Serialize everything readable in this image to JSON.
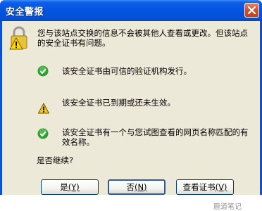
{
  "window": {
    "title": "安全警报",
    "close_icon": "close-icon"
  },
  "intro": {
    "icon": "lock-warning-icon",
    "text_line1": "您与该站点交换的信息不会被其他人查看或更改。但该站点",
    "text_line2": "的安全证书有问题。"
  },
  "checks": [
    {
      "icon": "check-ok-icon",
      "status": "ok",
      "line1": "该安全证书由可信的验证机构发行。",
      "line2": ""
    },
    {
      "icon": "warning-icon",
      "status": "warning",
      "line1": "该安全证书已到期或还未生效。",
      "line2": ""
    },
    {
      "icon": "check-ok-icon",
      "status": "ok",
      "line1": "该安全证书有一个与您试图查看的网页名称匹配的有",
      "line2": "效名称。"
    }
  ],
  "question": "是否继续?",
  "buttons": {
    "yes": {
      "label": "是",
      "accel": "(Y)"
    },
    "no": {
      "label": "否",
      "accel": "(N)"
    },
    "view": {
      "label": "查看证书",
      "accel": "(V)"
    }
  },
  "watermark": "鹿道笔记",
  "colors": {
    "titlebar": "#0554e0",
    "client": "#ece9d8",
    "ok_green": "#2f9e2f",
    "warning_yellow": "#f6c800"
  }
}
